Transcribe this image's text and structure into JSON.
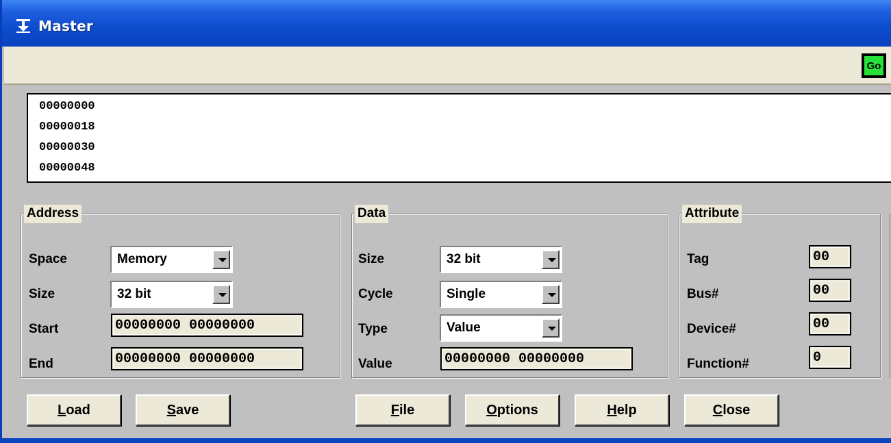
{
  "window": {
    "title": "Master"
  },
  "toolbar": {
    "go_label": "Go"
  },
  "list": {
    "items": [
      "00000000",
      "00000018",
      "00000030",
      "00000048"
    ]
  },
  "address": {
    "title": "Address",
    "space_label": "Space",
    "space_value": "Memory",
    "size_label": "Size",
    "size_value": "32 bit",
    "start_label": "Start",
    "start_value": "00000000 00000000",
    "end_label": "End",
    "end_value": "00000000 00000000"
  },
  "data": {
    "title": "Data",
    "size_label": "Size",
    "size_value": "32 bit",
    "cycle_label": "Cycle",
    "cycle_value": "Single",
    "type_label": "Type",
    "type_value": "Value",
    "value_label": "Value",
    "value_value": "00000000 00000000"
  },
  "attribute": {
    "title": "Attribute",
    "tag_label": "Tag",
    "tag_value": "00",
    "bus_label": "Bus#",
    "bus_value": "00",
    "device_label": "Device#",
    "device_value": "00",
    "function_label": "Function#",
    "function_value": "0"
  },
  "buttons": {
    "load": {
      "key": "L",
      "rest": "oad"
    },
    "save": {
      "key": "S",
      "rest": "ave"
    },
    "file": {
      "key": "F",
      "rest": "ile"
    },
    "options": {
      "key": "O",
      "rest": "ptions"
    },
    "help": {
      "key": "H",
      "rest": "elp"
    },
    "close": {
      "key": "C",
      "rest": "lose"
    }
  },
  "colors": {
    "titlebar": "#0c4ccc",
    "go_button": "#27e13a",
    "face": "#ece9d8"
  }
}
